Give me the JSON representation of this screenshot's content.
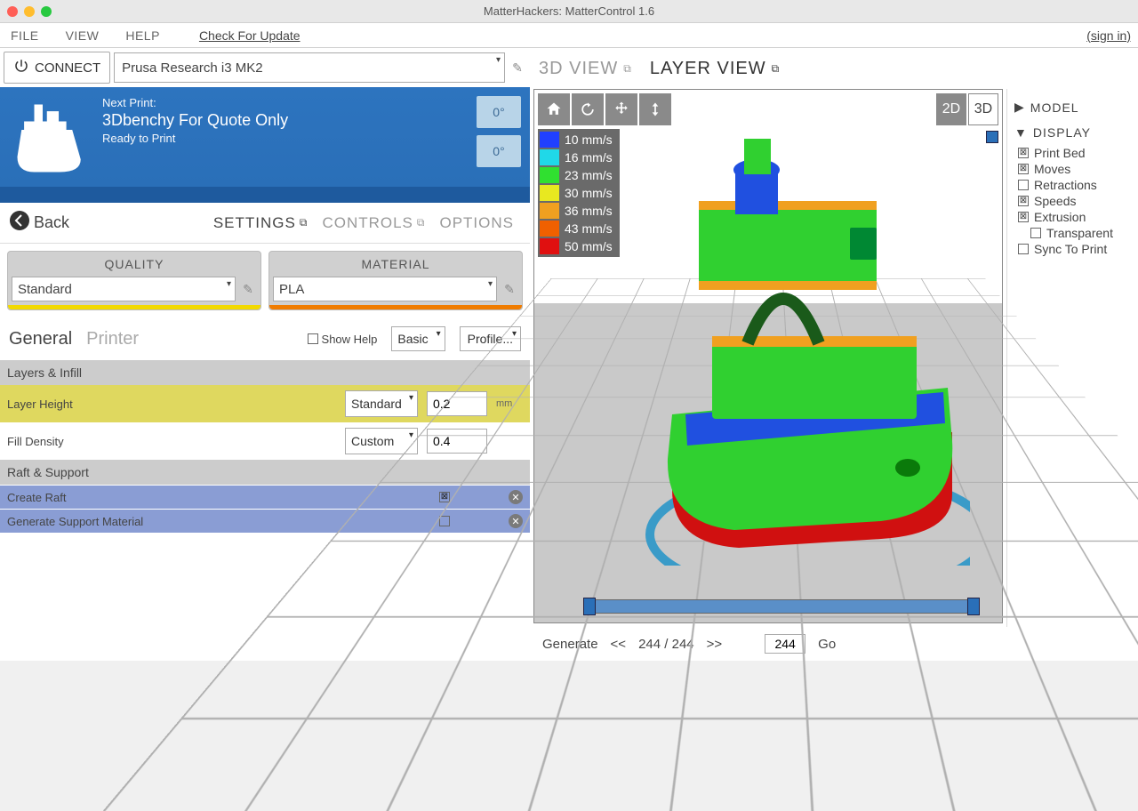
{
  "titlebar": {
    "title": "MatterHackers: MatterControl 1.6"
  },
  "menubar": {
    "file": "FILE",
    "view": "VIEW",
    "help": "HELP",
    "check_update": "Check For Update",
    "signin": "(sign in)"
  },
  "connect": {
    "button": "CONNECT",
    "printer": "Prusa Research i3 MK2"
  },
  "status": {
    "next_print_label": "Next Print:",
    "title": "3Dbenchy For Quote Only",
    "ready": "Ready to Print",
    "temp1": "0°",
    "temp2": "0°"
  },
  "back": "Back",
  "tabs": {
    "settings": "SETTINGS",
    "controls": "CONTROLS",
    "options": "OPTIONS"
  },
  "quality": {
    "label": "QUALITY",
    "value": "Standard"
  },
  "material": {
    "label": "MATERIAL",
    "value": "PLA"
  },
  "subtabs": {
    "general": "General",
    "printer": "Printer",
    "showhelp": "Show Help",
    "basic": "Basic",
    "profile": "Profile..."
  },
  "sections": {
    "layers": "Layers & Infill",
    "layer_height": {
      "label": "Layer Height",
      "preset": "Standard",
      "value": "0.2",
      "unit": "mm"
    },
    "fill_density": {
      "label": "Fill Density",
      "preset": "Custom",
      "value": "0.4"
    },
    "raft": "Raft & Support",
    "create_raft": "Create Raft",
    "gen_support": "Generate Support Material"
  },
  "view": {
    "tab_3d": "3D VIEW",
    "tab_layer": "LAYER VIEW",
    "mode_2d": "2D",
    "mode_3d": "3D",
    "legend": [
      {
        "c": "#2040ff",
        "t": "10 mm/s"
      },
      {
        "c": "#20d8e8",
        "t": "16 mm/s"
      },
      {
        "c": "#30e030",
        "t": "23 mm/s"
      },
      {
        "c": "#e8e820",
        "t": "30 mm/s"
      },
      {
        "c": "#f0a020",
        "t": "36 mm/s"
      },
      {
        "c": "#f06000",
        "t": "43 mm/s"
      },
      {
        "c": "#e01010",
        "t": "50 mm/s"
      }
    ]
  },
  "rpanel": {
    "model": "MODEL",
    "display": "DISPLAY",
    "items": [
      {
        "label": "Print Bed",
        "checked": true
      },
      {
        "label": "Moves",
        "checked": true
      },
      {
        "label": "Retractions",
        "checked": false
      },
      {
        "label": "Speeds",
        "checked": true
      },
      {
        "label": "Extrusion",
        "checked": true
      },
      {
        "label": "Transparent",
        "checked": false,
        "sub": true
      },
      {
        "label": "Sync To Print",
        "checked": false
      }
    ]
  },
  "generate": {
    "label": "Generate",
    "prev": "<<",
    "pos": "244 / 244",
    "next": ">>",
    "value": "244",
    "go": "Go"
  }
}
